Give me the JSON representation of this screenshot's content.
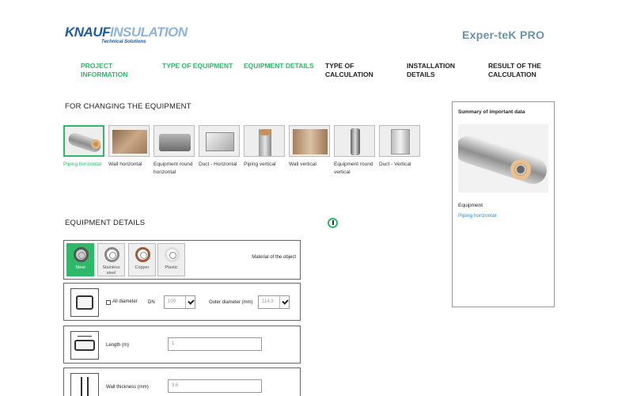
{
  "header": {
    "logo_brand_part1": "KNAUF",
    "logo_brand_part2": "INSULATION",
    "logo_tagline": "Technical Solutions",
    "app_title": "Exper-teK PRO"
  },
  "steps": [
    {
      "label": "PROJECT INFORMATION",
      "state": "done"
    },
    {
      "label": "TYPE OF EQUIPMENT",
      "state": "done"
    },
    {
      "label": "EQUIPMENT DETAILS",
      "state": "done"
    },
    {
      "label": "TYPE OF CALCULATION",
      "state": "todo"
    },
    {
      "label": "INSTALLATION DETAILS",
      "state": "todo"
    },
    {
      "label": "RESULT OF THE CALCULATION",
      "state": "todo"
    }
  ],
  "change_equipment": {
    "title": "FOR CHANGING THE EQUIPMENT",
    "items": [
      {
        "label": "Piping horizontal",
        "selected": true,
        "icon": "pipe-horizontal"
      },
      {
        "label": "Wall horizontal",
        "selected": false,
        "icon": "wall-horizontal"
      },
      {
        "label": "Equipment round horizontal",
        "selected": false,
        "icon": "equipment-round-horizontal"
      },
      {
        "label": "Duct - Horizontal",
        "selected": false,
        "icon": "duct-horizontal"
      },
      {
        "label": "Piping vertical",
        "selected": false,
        "icon": "pipe-vertical"
      },
      {
        "label": "Wall vertical",
        "selected": false,
        "icon": "wall-vertical"
      },
      {
        "label": "Equipment round vertical",
        "selected": false,
        "icon": "equipment-round-vertical"
      },
      {
        "label": "Duct - Vertical",
        "selected": false,
        "icon": "duct-vertical"
      }
    ]
  },
  "summary": {
    "title": "Summary of important data",
    "equipment_label": "Equipment",
    "equipment_value": "Piping horizontal"
  },
  "equipment_details": {
    "title": "EQUIPMENT DETAILS",
    "materials": [
      {
        "label": "Steel",
        "selected": true
      },
      {
        "label": "Stainless steel",
        "selected": false
      },
      {
        "label": "Copper",
        "selected": false
      },
      {
        "label": "Plastic",
        "selected": false
      }
    ],
    "material_caption": "Material of the object",
    "diameter": {
      "all_diameter_label": "All diameter",
      "dn_label": "DN",
      "dn_value": "100",
      "outer_label": "Outer diameter (mm)",
      "outer_value": "114.3"
    },
    "length": {
      "label": "Length (m)",
      "value": "1"
    },
    "wall_thickness": {
      "label": "Wall thickness (mm)",
      "value": "3.6"
    }
  },
  "colors": {
    "accent_green": "#2fb86a",
    "brand_blue": "#1d5aa8",
    "title_blue_gray": "#6a93a8",
    "link_blue": "#2a8fd6"
  }
}
